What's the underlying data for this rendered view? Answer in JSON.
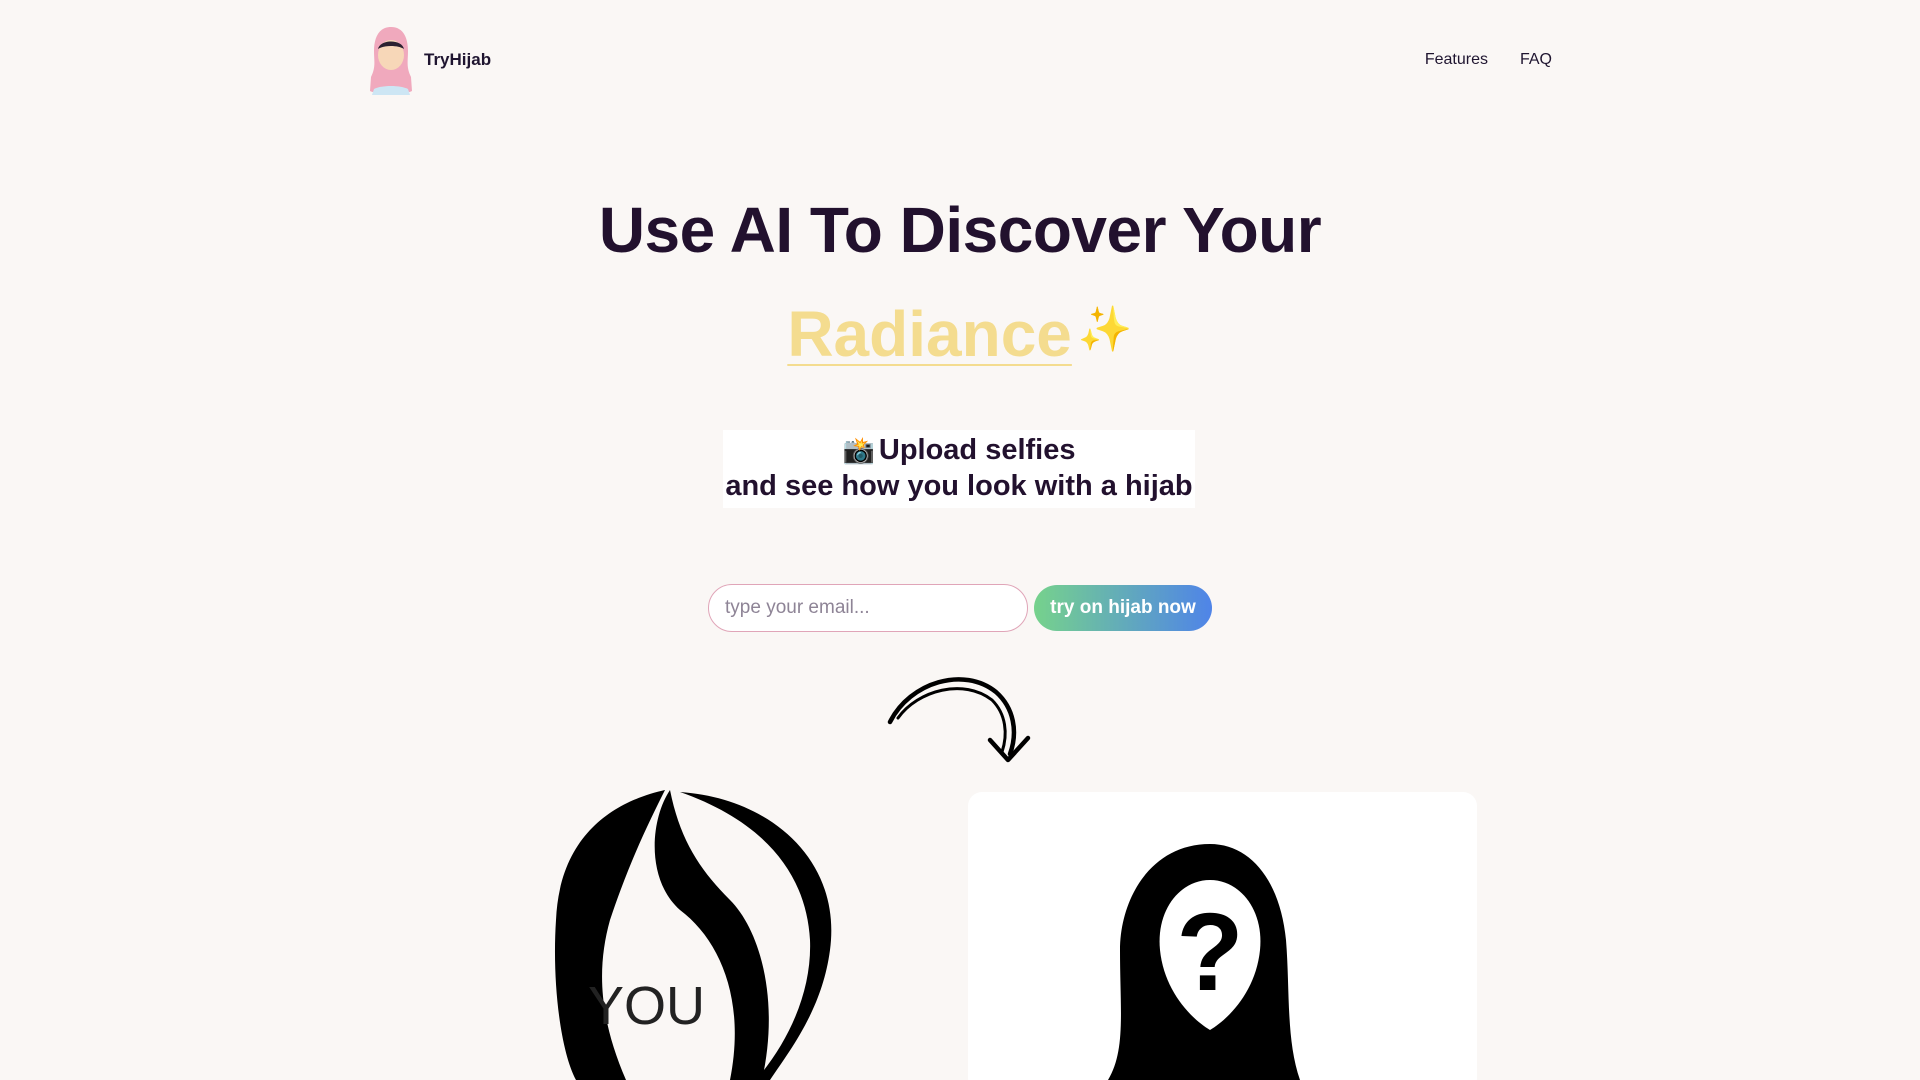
{
  "brand": {
    "name": "TryHijab",
    "logo_icon": "hijab-girl-logo-icon"
  },
  "nav": {
    "items": [
      {
        "label": "Features"
      },
      {
        "label": "FAQ"
      }
    ]
  },
  "hero": {
    "title": "Use AI To Discover Your",
    "highlight": "Radiance",
    "sparkle_icon": "sparkles-icon",
    "highlight_color": "#f4dc8f"
  },
  "subtitle": {
    "camera_icon": "📸",
    "line1": "Upload selfies",
    "line2": "and see how you look with a hijab"
  },
  "form": {
    "email_placeholder": "type your email...",
    "email_value": "",
    "cta_label": "try on hijab now",
    "cta_gradient": [
      "#76d28c",
      "#4f84e8"
    ]
  },
  "illustrations": {
    "arrow_icon": "curved-arrow-icon",
    "you_label": "YOU",
    "mystery_label": "?"
  }
}
